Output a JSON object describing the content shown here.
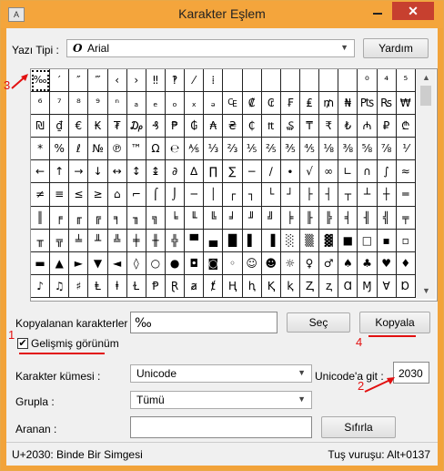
{
  "window": {
    "title": "Karakter Eşlem",
    "close": "✕"
  },
  "font": {
    "label": "Yazı Tipi :",
    "value": "Arial",
    "icon": "O",
    "help_button": "Yardım"
  },
  "grid": {
    "cells": [
      "‰",
      "′",
      "″",
      "‴",
      "‹",
      "›",
      "‼",
      "‽",
      "⁄",
      "⁞",
      "",
      "",
      "",
      "",
      "",
      "",
      "",
      "⁰",
      "⁴",
      "⁵",
      "⁶",
      "⁷",
      "⁸",
      "⁹",
      "ⁿ",
      "ₐ",
      "ₑ",
      "ₒ",
      "ₓ",
      "ₔ",
      "₠",
      "₡",
      "₢",
      "₣",
      "₤",
      "₥",
      "₦",
      "₧",
      "₨",
      "₩",
      "₪",
      "₫",
      "€",
      "₭",
      "₮",
      "₯",
      "₰",
      "₱",
      "₲",
      "₳",
      "₴",
      "₵",
      "₶",
      "₷",
      "₸",
      "₹",
      "₺",
      "₼",
      "₽",
      "₾",
      "*",
      "%",
      "ℓ",
      "№",
      "℗",
      "™",
      "Ω",
      "℮",
      "⅍",
      "⅓",
      "⅔",
      "⅕",
      "⅖",
      "⅗",
      "⅘",
      "⅛",
      "⅜",
      "⅝",
      "⅞",
      "⅟",
      "←",
      "↑",
      "→",
      "↓",
      "↔",
      "↕",
      "↨",
      "∂",
      "∆",
      "∏",
      "∑",
      "−",
      "∕",
      "∙",
      "√",
      "∞",
      "∟",
      "∩",
      "∫",
      "≈",
      "≠",
      "≡",
      "≤",
      "≥",
      "⌂",
      "⌐",
      "⌠",
      "⌡",
      "─",
      "│",
      "┌",
      "┐",
      "└",
      "┘",
      "├",
      "┤",
      "┬",
      "┴",
      "┼",
      "═",
      "║",
      "╒",
      "╓",
      "╔",
      "╕",
      "╖",
      "╗",
      "╘",
      "╙",
      "╚",
      "╛",
      "╜",
      "╝",
      "╞",
      "╟",
      "╠",
      "╡",
      "╢",
      "╣",
      "╤",
      "╥",
      "╦",
      "╧",
      "╨",
      "╩",
      "╪",
      "╫",
      "╬",
      "▀",
      "▄",
      "█",
      "▌",
      "▐",
      "░",
      "▒",
      "▓",
      "■",
      "□",
      "▪",
      "▫",
      "▬",
      "▲",
      "►",
      "▼",
      "◄",
      "◊",
      "○",
      "●",
      "◘",
      "◙",
      "◦",
      "☺",
      "☻",
      "☼",
      "♀",
      "♂",
      "♠",
      "♣",
      "♥",
      "♦",
      "♪",
      "♫",
      "♯",
      "Ⱡ",
      "ⱡ",
      "Ɫ",
      "Ᵽ",
      "Ɽ",
      "ⱥ",
      "ⱦ",
      "Ⱨ",
      "ⱨ",
      "Ⱪ",
      "ⱪ",
      "Ⱬ",
      "ⱬ",
      "Ɑ",
      "Ɱ",
      "Ɐ",
      "Ɒ"
    ]
  },
  "copy": {
    "label": "Kopyalanan karakterler :",
    "value": "‰",
    "select_button": "Seç",
    "copy_button": "Kopyala"
  },
  "advanced": {
    "label": "Gelişmiş görünüm",
    "checked": "✔"
  },
  "charset": {
    "label": "Karakter kümesi :",
    "value": "Unicode"
  },
  "goto": {
    "label": "Unicode'a git :",
    "value": "2030"
  },
  "group": {
    "label": "Grupla :",
    "value": "Tümü"
  },
  "search": {
    "label": "Aranan :",
    "value": "",
    "reset_button": "Sıfırla"
  },
  "status": {
    "left": "U+2030: Binde Bir Simgesi",
    "right": "Tuş vuruşu: Alt+0137"
  },
  "annotations": {
    "a1": "1",
    "a2": "2",
    "a3": "3",
    "a4": "4"
  }
}
